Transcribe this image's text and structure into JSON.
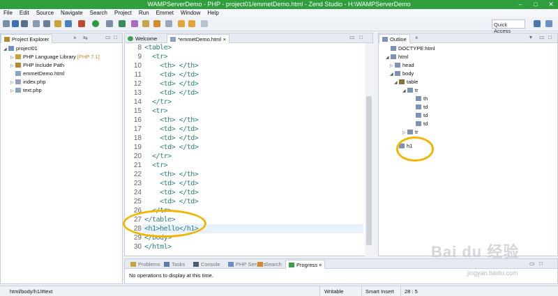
{
  "window": {
    "title": "WAMPServerDemo - PHP - project01/emmetDemo.html - Zend Studio - H:\\WAMPServerDemo"
  },
  "menu": [
    "File",
    "Edit",
    "Source",
    "Navigate",
    "Search",
    "Project",
    "Run",
    "Emmet",
    "Window",
    "Help"
  ],
  "quick_access": "Quick Access",
  "explorer": {
    "tab": "Project Explorer",
    "items": [
      {
        "label": "project01",
        "tag": ""
      },
      {
        "label": "PHP Language Library",
        "tag": "[PHP 7.1]"
      },
      {
        "label": "PHP Include Path",
        "tag": ""
      },
      {
        "label": "emmetDemo.html",
        "tag": ""
      },
      {
        "label": "index.php",
        "tag": ""
      },
      {
        "label": "text.php",
        "tag": ""
      }
    ]
  },
  "editor": {
    "tabs": [
      "Welcome",
      "*emmetDemo.html"
    ],
    "lines": [
      {
        "n": "8",
        "code": "<table>"
      },
      {
        "n": "9",
        "code": "  <tr>"
      },
      {
        "n": "10",
        "code": "    <th> </th>"
      },
      {
        "n": "11",
        "code": "    <td> </td>"
      },
      {
        "n": "12",
        "code": "    <td> </td>"
      },
      {
        "n": "13",
        "code": "    <td> </td>"
      },
      {
        "n": "14",
        "code": "  </tr>"
      },
      {
        "n": "15",
        "code": "  <tr>"
      },
      {
        "n": "16",
        "code": "    <th> </th>"
      },
      {
        "n": "17",
        "code": "    <td> </td>"
      },
      {
        "n": "18",
        "code": "    <td> </td>"
      },
      {
        "n": "19",
        "code": "    <td> </td>"
      },
      {
        "n": "20",
        "code": "  </tr>"
      },
      {
        "n": "21",
        "code": "  <tr>"
      },
      {
        "n": "22",
        "code": "    <th> </th>"
      },
      {
        "n": "23",
        "code": "    <td> </td>"
      },
      {
        "n": "24",
        "code": "    <td> </td>"
      },
      {
        "n": "25",
        "code": "    <td> </td>"
      },
      {
        "n": "26",
        "code": "  </tr>"
      },
      {
        "n": "27",
        "code": "</table>"
      },
      {
        "n": "28",
        "code": "<h1>hello</h1>"
      },
      {
        "n": "29",
        "code": "</body>"
      },
      {
        "n": "30",
        "code": "</html>"
      }
    ]
  },
  "outline": {
    "tab": "Outline",
    "items": [
      "DOCTYPE:html",
      "html",
      "head",
      "body",
      "table",
      "tr",
      "th",
      "td",
      "td",
      "td",
      "tr",
      "h1"
    ]
  },
  "bottom": {
    "tabs": [
      "Problems",
      "Tasks",
      "Console",
      "PHP Servers",
      "Search",
      "Progress"
    ],
    "message": "No operations to display at this time."
  },
  "status": {
    "path": "html/body/h1/#text",
    "mode": "Writable",
    "insert": "Smart Insert",
    "pos": "28 : 5"
  },
  "watermark": {
    "brand": "Bai du 经验",
    "url": "jingyan.baidu.com"
  },
  "colors": {
    "titlebar": "#2f9e3d",
    "code": "#2e7f7a",
    "highlight": "#f2b600"
  }
}
